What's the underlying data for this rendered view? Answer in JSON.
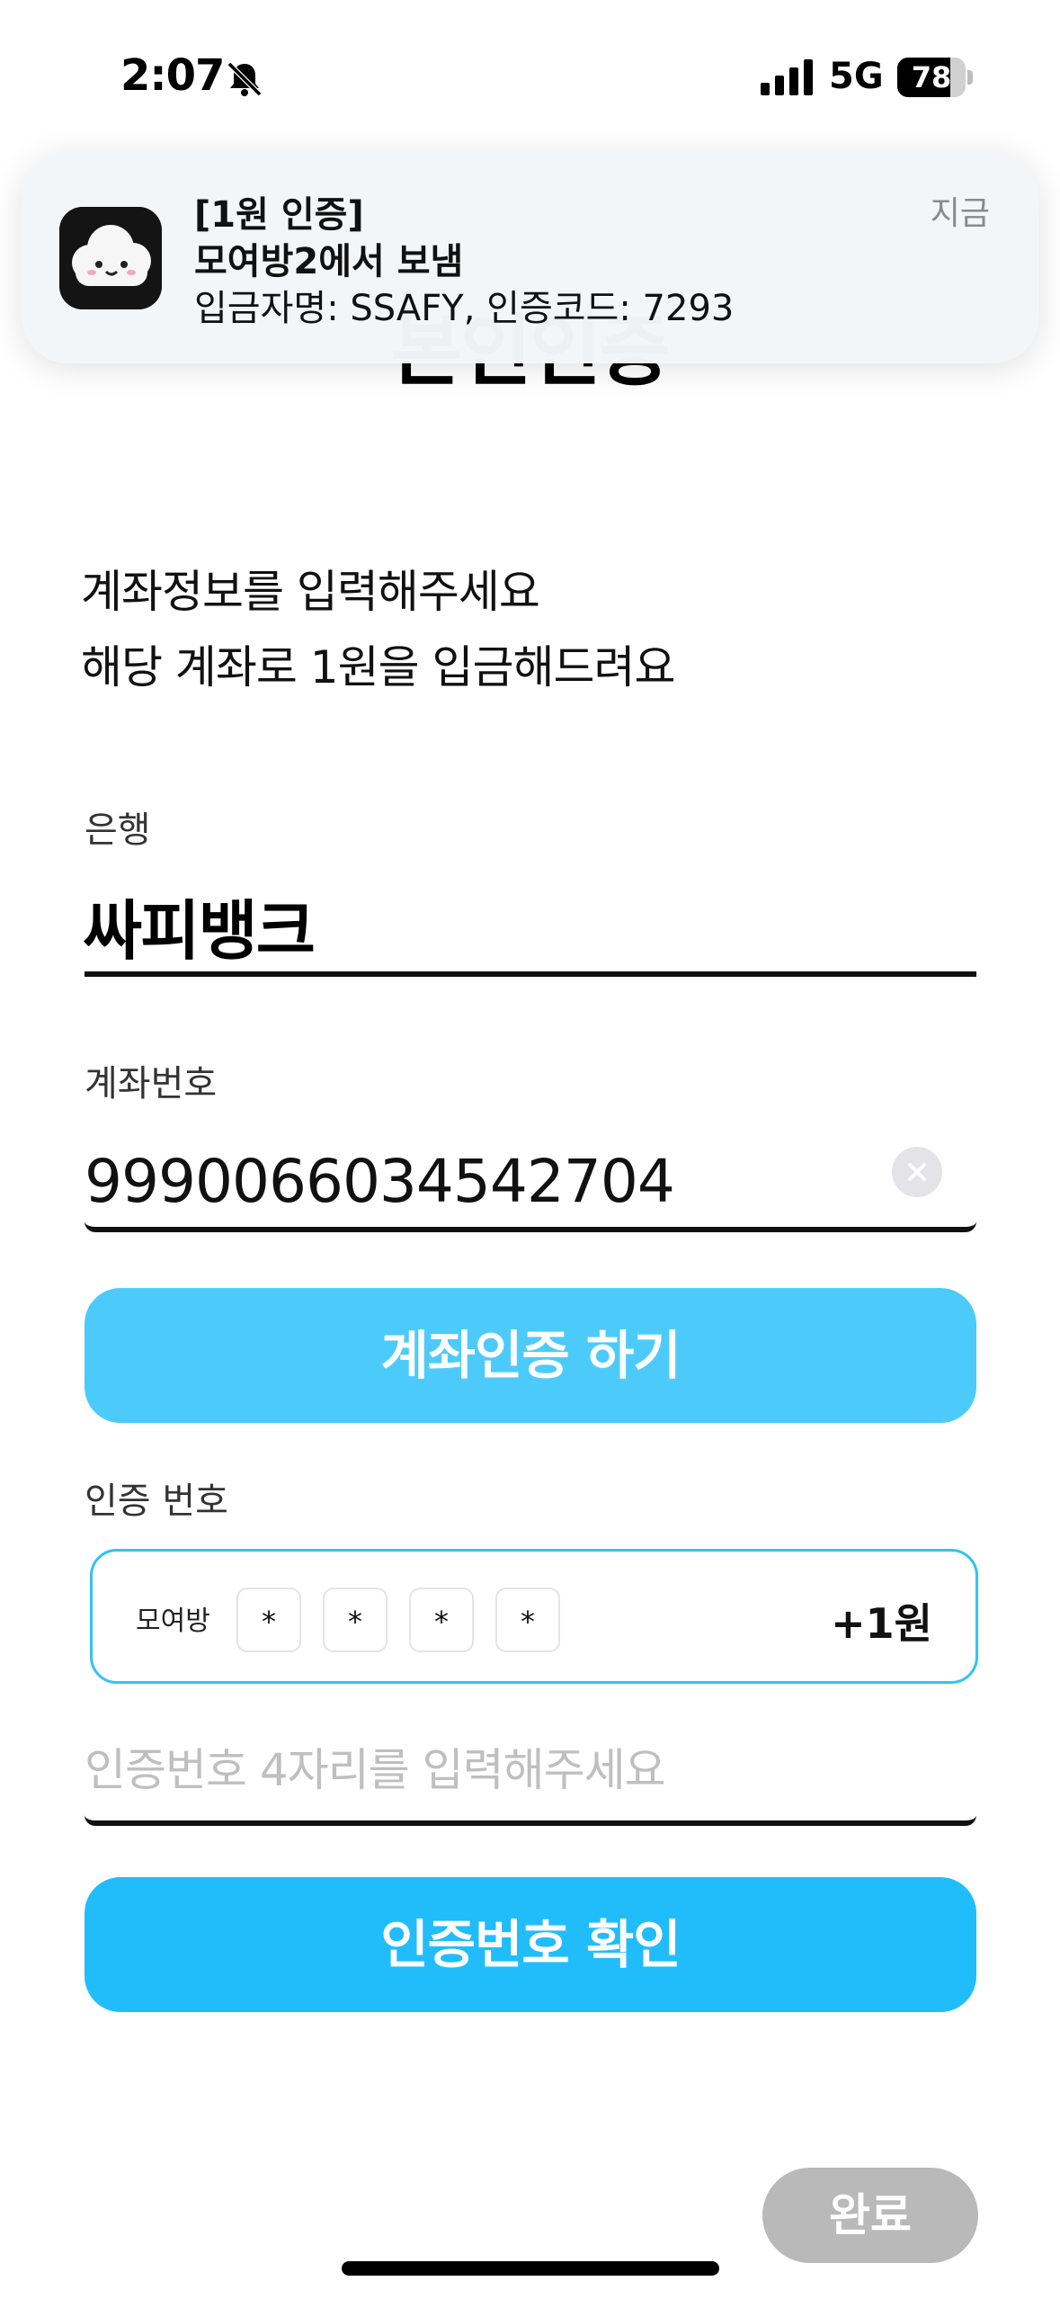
{
  "status_bar": {
    "time": "2:07",
    "network": "5G",
    "battery": "78",
    "battery_level": 0.78
  },
  "notification": {
    "title": "[1원 인증]",
    "subtitle": "모여방2에서 보냄",
    "body": "입금자명: SSAFY, 인증코드: 7293",
    "time": "지금",
    "app_icon": "cloud-mascot-icon"
  },
  "page": {
    "title": "본인인증",
    "instruction_line1": "계좌정보를 입력해주세요",
    "instruction_line2": "해당 계좌로 1원을 입금해드려요"
  },
  "bank": {
    "label": "은행",
    "value": "싸피뱅크"
  },
  "account": {
    "label": "계좌번호",
    "value": "9990066034542704"
  },
  "buttons": {
    "verify_account": "계좌인증 하기",
    "confirm_code": "인증번호 확인",
    "done": "완료"
  },
  "verification": {
    "label": "인증 번호",
    "prefix": "모여방",
    "digits": [
      "*",
      "*",
      "*",
      "*"
    ],
    "amount": "+1원",
    "placeholder": "인증번호 4자리를 입력해주세요"
  },
  "colors": {
    "verify_button": "#4ccbfb",
    "confirm_button": "#21bdfb",
    "done_button_disabled": "#b9b9b9",
    "code_box_border": "#35c2f5"
  }
}
